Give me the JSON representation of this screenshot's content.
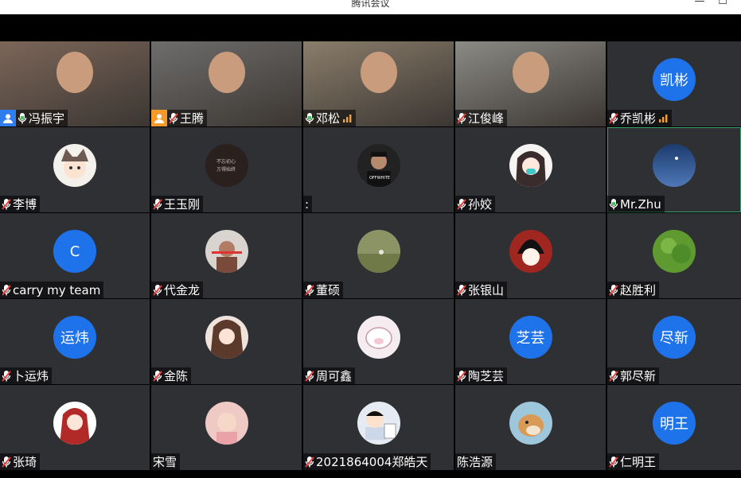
{
  "window": {
    "title": "腾讯会议",
    "minimize": "—",
    "maximize": "☐"
  },
  "colors": {
    "tile_bg": "#2f3034",
    "avatar_blue": "#1e72ea",
    "host_blue": "#2f7df0",
    "cohost_orange": "#f39a2b",
    "active_green": "#3aa56a"
  },
  "participants": [
    {
      "name": "冯振宇",
      "type": "video",
      "mic": "on",
      "badge": "host"
    },
    {
      "name": "王腾",
      "type": "video",
      "mic": "muted",
      "badge": "cohost"
    },
    {
      "name": "邓松",
      "type": "video",
      "mic": "on",
      "signal": true
    },
    {
      "name": "江俊峰",
      "type": "video",
      "mic": "muted"
    },
    {
      "name": "乔凯彬",
      "type": "text-avatar",
      "avatar_text": "凯彬",
      "mic": "muted",
      "signal": true
    },
    {
      "name": "李博",
      "type": "image-avatar",
      "avatar_icon": "cat-girl-avatar",
      "mic": "muted"
    },
    {
      "name": "王玉刚",
      "type": "image-avatar",
      "avatar_icon": "calligraphy-avatar",
      "mic": "muted"
    },
    {
      "name": ":",
      "type": "image-avatar",
      "avatar_icon": "cap-man-avatar",
      "mic": "none"
    },
    {
      "name": "孙姣",
      "type": "image-avatar",
      "avatar_icon": "masked-girl-avatar",
      "mic": "muted"
    },
    {
      "name": "Mr.Zhu",
      "type": "image-avatar",
      "avatar_icon": "night-sky-avatar",
      "mic": "on",
      "active": true
    },
    {
      "name": "carry my team",
      "type": "text-avatar",
      "avatar_text": "C",
      "mic": "muted"
    },
    {
      "name": "代金龙",
      "type": "image-avatar",
      "avatar_icon": "person-photo-avatar",
      "mic": "muted"
    },
    {
      "name": "董硕",
      "type": "image-avatar",
      "avatar_icon": "grass-field-avatar",
      "mic": "muted"
    },
    {
      "name": "张银山",
      "type": "image-avatar",
      "avatar_icon": "anime-boy-avatar",
      "mic": "muted"
    },
    {
      "name": "赵胜利",
      "type": "image-avatar",
      "avatar_icon": "green-plant-avatar",
      "mic": "muted"
    },
    {
      "name": "卜运炜",
      "type": "text-avatar",
      "avatar_text": "运炜",
      "mic": "muted"
    },
    {
      "name": "金陈",
      "type": "image-avatar",
      "avatar_icon": "long-hair-avatar",
      "mic": "muted"
    },
    {
      "name": "周可鑫",
      "type": "image-avatar",
      "avatar_icon": "cartoon-pig-avatar",
      "mic": "muted"
    },
    {
      "name": "陶芝芸",
      "type": "text-avatar",
      "avatar_text": "芝芸",
      "mic": "muted"
    },
    {
      "name": "郭尽新",
      "type": "text-avatar",
      "avatar_text": "尽新",
      "mic": "muted"
    },
    {
      "name": "张琦",
      "type": "image-avatar",
      "avatar_icon": "red-hair-girl-avatar",
      "mic": "muted"
    },
    {
      "name": "宋雪",
      "type": "image-avatar",
      "avatar_icon": "baby-photo-avatar",
      "mic": "none"
    },
    {
      "name": "2021864004郑皓天",
      "type": "image-avatar",
      "avatar_icon": "crayon-shin-avatar",
      "mic": "muted"
    },
    {
      "name": "陈浩源",
      "type": "image-avatar",
      "avatar_icon": "shiba-dog-avatar",
      "mic": "none"
    },
    {
      "name": "仁明王",
      "type": "text-avatar",
      "avatar_text": "明王",
      "mic": "muted"
    }
  ]
}
